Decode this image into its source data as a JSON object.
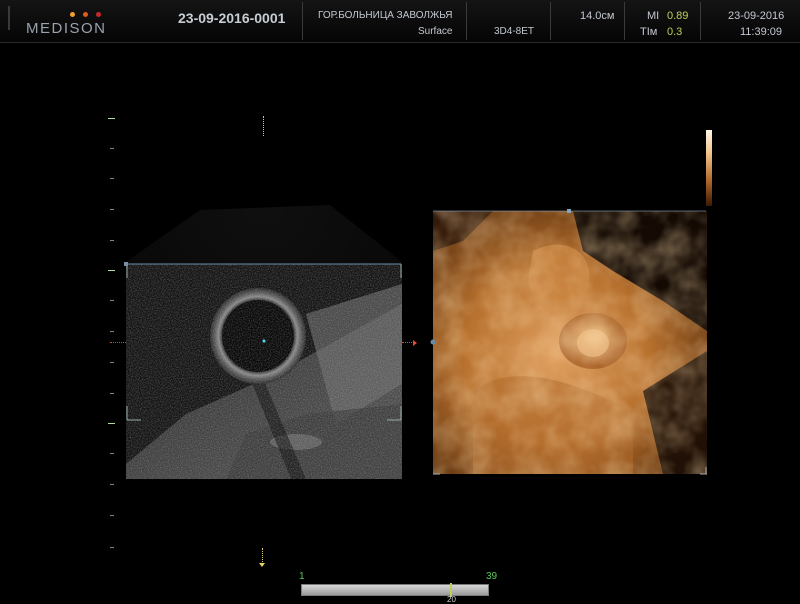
{
  "header": {
    "logo": "MEDISON",
    "patient_id": "23-09-2016-0001",
    "hospital": "ГОР.БОЛЬНИЦА ЗАВОЛЖЬЯ",
    "preset": "Surface",
    "probe": "3D4-8ET",
    "depth": "14.0см",
    "mi_label": "MI",
    "mi_value": "0.89",
    "ti_label": "TIм",
    "ti_value": "0.3",
    "date": "23-09-2016",
    "time": "11:39:09"
  },
  "slider": {
    "min": "1",
    "max": "39",
    "current": "20"
  },
  "colors": {
    "logo_dot_1": "#f0a030",
    "logo_dot_2": "#e05a1a",
    "logo_dot_3": "#c82828",
    "value_green": "#b9d15a",
    "marker_red": "#e84a3a"
  }
}
